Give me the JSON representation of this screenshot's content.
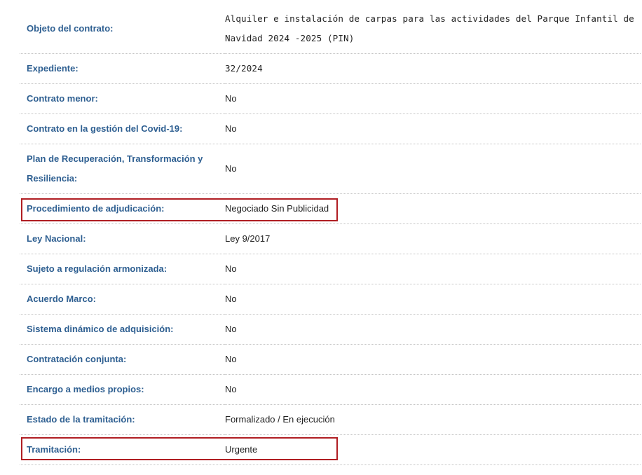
{
  "rows": [
    {
      "label": "Objeto del contrato:",
      "value": "Alquiler e instalación de carpas para las actividades del Parque Infantil de Navidad 2024 -2025 (PIN)"
    },
    {
      "label": "Expediente:",
      "value": "32/2024"
    },
    {
      "label": "Contrato menor:",
      "value": "No"
    },
    {
      "label": "Contrato en la gestión del Covid-19:",
      "value": "No"
    },
    {
      "label": "Plan de Recuperación, Transformación y Resiliencia:",
      "value": "No"
    },
    {
      "label": "Procedimiento de adjudicación:",
      "value": "Negociado Sin Publicidad"
    },
    {
      "label": "Ley Nacional:",
      "value": "Ley 9/2017"
    },
    {
      "label": "Sujeto a regulación armonizada:",
      "value": "No"
    },
    {
      "label": "Acuerdo Marco:",
      "value": "No"
    },
    {
      "label": "Sistema dinámico de adquisición:",
      "value": "No"
    },
    {
      "label": "Contratación conjunta:",
      "value": "No"
    },
    {
      "label": "Encargo a medios propios:",
      "value": "No"
    },
    {
      "label": "Estado de la tramitación:",
      "value": "Formalizado / En ejecución"
    },
    {
      "label": "Tramitación:",
      "value": "Urgente"
    }
  ],
  "highlight_color": "#b01e23",
  "label_color": "#2e5f91"
}
